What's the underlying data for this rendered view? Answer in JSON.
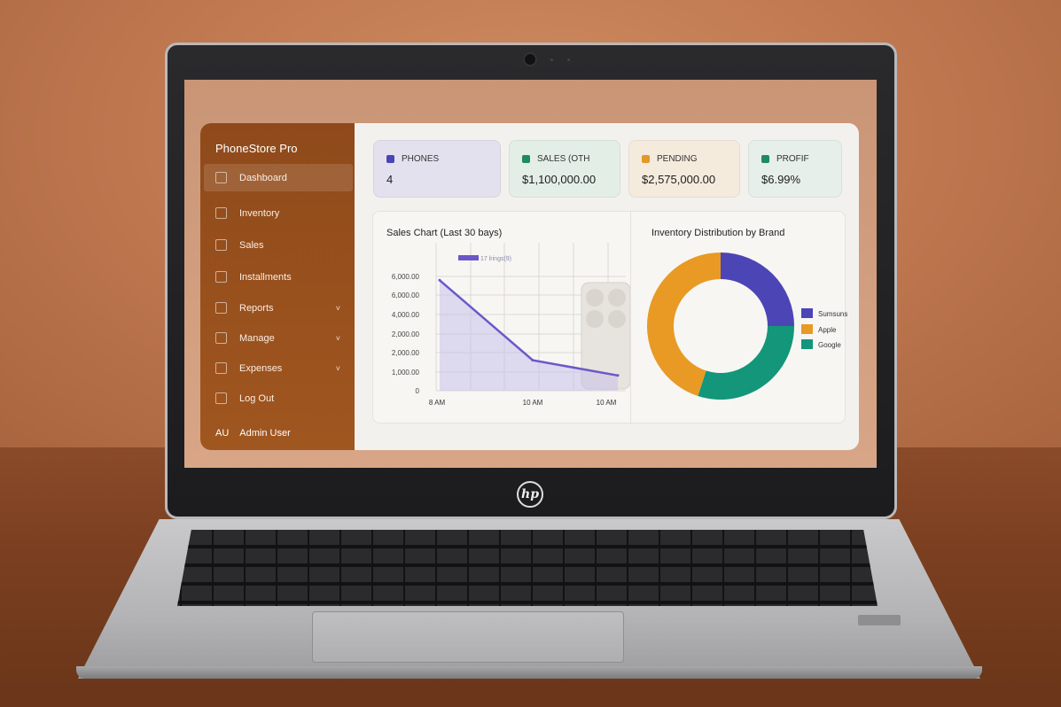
{
  "app": {
    "brand": "PhoneStore Pro",
    "nav": [
      {
        "label": "Dashboard",
        "icon": "home-icon",
        "active": true,
        "chevron": false
      },
      {
        "label": "Inventory",
        "icon": "box-icon",
        "active": false,
        "chevron": false
      },
      {
        "label": "Sales",
        "icon": "bar-chart-icon",
        "active": false,
        "chevron": false
      },
      {
        "label": "Installments",
        "icon": "cap-icon",
        "active": false,
        "chevron": false
      },
      {
        "label": "Reports",
        "icon": "document-icon",
        "active": false,
        "chevron": true
      },
      {
        "label": "Manage",
        "icon": "settings-icon",
        "active": false,
        "chevron": true
      },
      {
        "label": "Expenses",
        "icon": "wallet-icon",
        "active": false,
        "chevron": true
      },
      {
        "label": "Log Out",
        "icon": "logout-icon",
        "active": false,
        "chevron": false
      }
    ],
    "user": {
      "initials": "AU",
      "name": "Admin User"
    }
  },
  "stats": [
    {
      "label": "PHONES",
      "value": "4",
      "icon": "phone-icon",
      "bg": "#e4e1ee",
      "accent": "#4b45b6"
    },
    {
      "label": "SALES (OTH",
      "value": "$1,100,000.00",
      "icon": "tag-icon",
      "bg": "#e3eee7",
      "accent": "#1f8a62"
    },
    {
      "label": "PENDING",
      "value": "$2,575,000.00",
      "icon": "dollar-icon",
      "bg": "#f4ebdd",
      "accent": "#e09a25"
    },
    {
      "label": "PROFIF",
      "value": "$6.99%",
      "icon": "person-icon",
      "bg": "#e6efe9",
      "accent": "#1f8a62"
    }
  ],
  "chart_data": [
    {
      "type": "line",
      "title": "Sales Chart (Last 30 bays)",
      "legend": "17 lrings(9)",
      "y_ticks": [
        "6,000.00",
        "6,000.00",
        "4,000.00",
        "2,000.00",
        "2,000.00",
        "1,000.00",
        "0"
      ],
      "x_ticks": [
        "8 AM",
        "10 AM",
        "10 AM"
      ],
      "series": [
        {
          "name": "17 lrings(9)",
          "color": "#6a58c9",
          "x": [
            "8 AM",
            "10 AM",
            "10 AM"
          ],
          "values": [
            5800,
            1600,
            800
          ]
        }
      ],
      "ylim": [
        0,
        6000
      ]
    },
    {
      "type": "pie",
      "title": "Inventory Distribution by Brand",
      "labels": [
        "Sumsuns",
        "Apple",
        "Google"
      ],
      "values": [
        25,
        45,
        30
      ],
      "colors": [
        "#4b45b6",
        "#e89a25",
        "#13967a"
      ]
    }
  ]
}
